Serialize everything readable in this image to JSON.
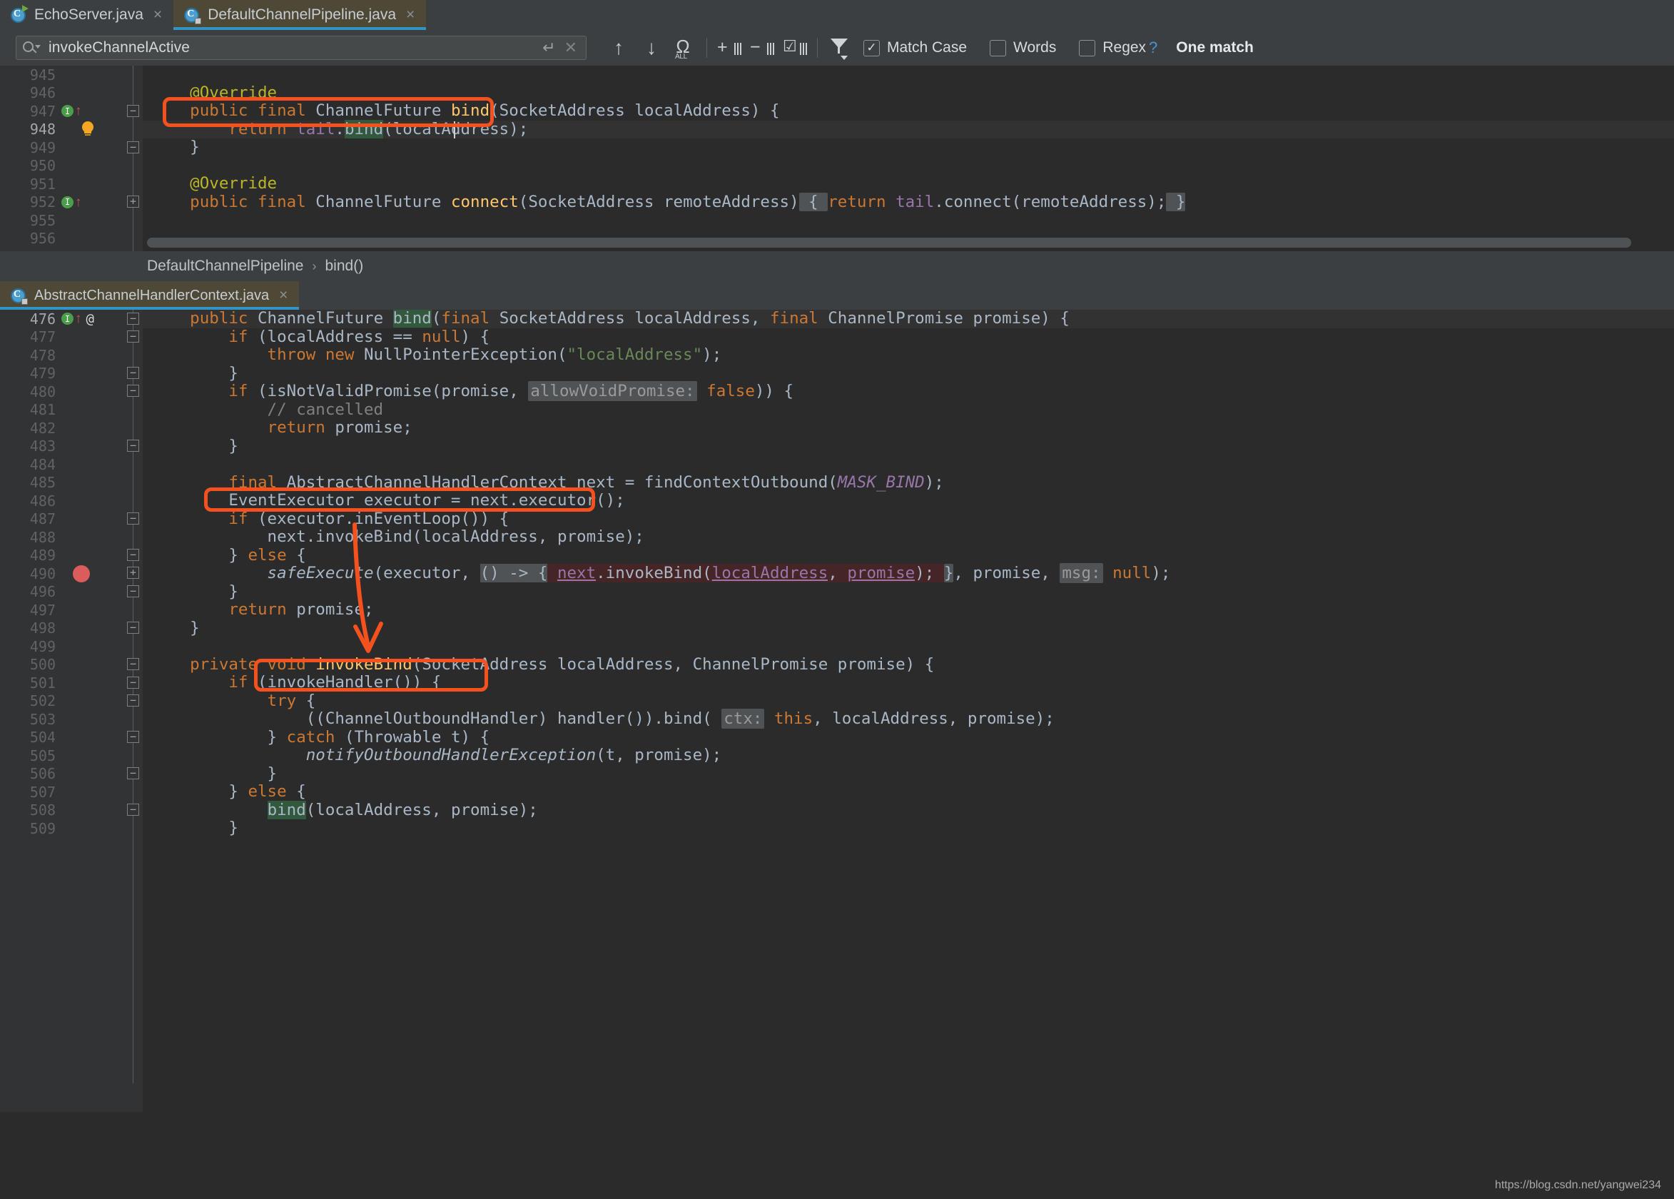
{
  "tabs": [
    {
      "label": "EchoServer.java",
      "close": "×",
      "active": false,
      "icon": "java-class-icon"
    },
    {
      "label": "DefaultChannelPipeline.java",
      "close": "×",
      "active": true,
      "icon": "java-class-locked-icon"
    }
  ],
  "search": {
    "value": "invokeChannelActive",
    "enter_icon": "↵",
    "clear_icon": "✕",
    "prev_icon": "↑",
    "next_icon": "↓",
    "select_all_label": "ALL",
    "add_line_icon": "+",
    "remove_line_icon": "−",
    "select_all_occurrences_icon": "☑",
    "filter_icon": "filter",
    "match_case_label": "Match Case",
    "match_case_checked": true,
    "words_label": "Words",
    "words_checked": false,
    "regex_label": "Regex",
    "regex_checked": false,
    "help_label": "?",
    "status": "One match"
  },
  "breadcrumb": {
    "class_name": "DefaultChannelPipeline",
    "separator": "›",
    "member": "bind()"
  },
  "tab2": {
    "label": "AbstractChannelHandlerContext.java",
    "close": "×",
    "icon": "java-class-locked-icon"
  },
  "editor1": {
    "file": "DefaultChannelPipeline.java",
    "lines": [
      {
        "n": "945",
        "text": ""
      },
      {
        "n": "946",
        "text": "    @Override"
      },
      {
        "n": "947",
        "text": "    public final ChannelFuture bind(SocketAddress localAddress) {",
        "marker": "override-up"
      },
      {
        "n": "948",
        "text": "        return tail.bind(localAddress);",
        "current": true,
        "bulb": true
      },
      {
        "n": "949",
        "text": "    }"
      },
      {
        "n": "950",
        "text": ""
      },
      {
        "n": "951",
        "text": "    @Override"
      },
      {
        "n": "952",
        "text": "    public final ChannelFuture connect(SocketAddress remoteAddress) { return tail.connect(remoteAddress); }",
        "marker": "override-up"
      },
      {
        "n": "955",
        "text": ""
      },
      {
        "n": "956",
        "text": ""
      }
    ]
  },
  "editor2": {
    "file": "AbstractChannelHandlerContext.java",
    "lines": [
      {
        "n": "476",
        "text": "    public ChannelFuture bind(final SocketAddress localAddress, final ChannelPromise promise) {",
        "current": true,
        "marker": "override-up",
        "at": "@"
      },
      {
        "n": "477",
        "text": "        if (localAddress == null) {"
      },
      {
        "n": "478",
        "text": "            throw new NullPointerException(\"localAddress\");"
      },
      {
        "n": "479",
        "text": "        }"
      },
      {
        "n": "480",
        "text": "        if (isNotValidPromise(promise,  allowVoidPromise: false)) {"
      },
      {
        "n": "481",
        "text": "            // cancelled"
      },
      {
        "n": "482",
        "text": "            return promise;"
      },
      {
        "n": "483",
        "text": "        }"
      },
      {
        "n": "484",
        "text": ""
      },
      {
        "n": "485",
        "text": "        final AbstractChannelHandlerContext next = findContextOutbound(MASK_BIND);"
      },
      {
        "n": "486",
        "text": "        EventExecutor executor = next.executor();"
      },
      {
        "n": "487",
        "text": "        if (executor.inEventLoop()) {"
      },
      {
        "n": "488",
        "text": "            next.invokeBind(localAddress, promise);"
      },
      {
        "n": "489",
        "text": "        } else {"
      },
      {
        "n": "490",
        "text": "            safeExecute(executor,  () -> { next.invokeBind(localAddress, promise); }, promise,  msg: null);",
        "breakpoint": true
      },
      {
        "n": "496",
        "text": "        }"
      },
      {
        "n": "497",
        "text": "        return promise;"
      },
      {
        "n": "498",
        "text": "    }"
      },
      {
        "n": "499",
        "text": ""
      },
      {
        "n": "500",
        "text": "    private void invokeBind(SocketAddress localAddress, ChannelPromise promise) {"
      },
      {
        "n": "501",
        "text": "        if (invokeHandler()) {"
      },
      {
        "n": "502",
        "text": "            try {"
      },
      {
        "n": "503",
        "text": "                ((ChannelOutboundHandler) handler()).bind( ctx: this, localAddress, promise);"
      },
      {
        "n": "504",
        "text": "            } catch (Throwable t) {"
      },
      {
        "n": "505",
        "text": "                notifyOutboundHandlerException(t, promise);"
      },
      {
        "n": "506",
        "text": "            }"
      },
      {
        "n": "507",
        "text": "        } else {"
      },
      {
        "n": "508",
        "text": "            bind(localAddress, promise);"
      },
      {
        "n": "509",
        "text": "        }"
      }
    ]
  },
  "annotations": {
    "color": "#f4511e",
    "boxes": [
      {
        "name": "highlight-return-tail-bind",
        "target": "return tail.bind(localAddress);"
      },
      {
        "name": "highlight-next-invokebind",
        "target": "next.invokeBind(localAddress, promise);"
      },
      {
        "name": "highlight-channeloutboundhandler-cast",
        "target": "((ChannelOutboundHandler)"
      }
    ],
    "arrow": {
      "name": "flow-arrow-safeexecute-to-invokebind",
      "from": "line 490 safeExecute",
      "to": "line 503 cast"
    }
  },
  "watermark": "https://blog.csdn.net/yangwei234"
}
